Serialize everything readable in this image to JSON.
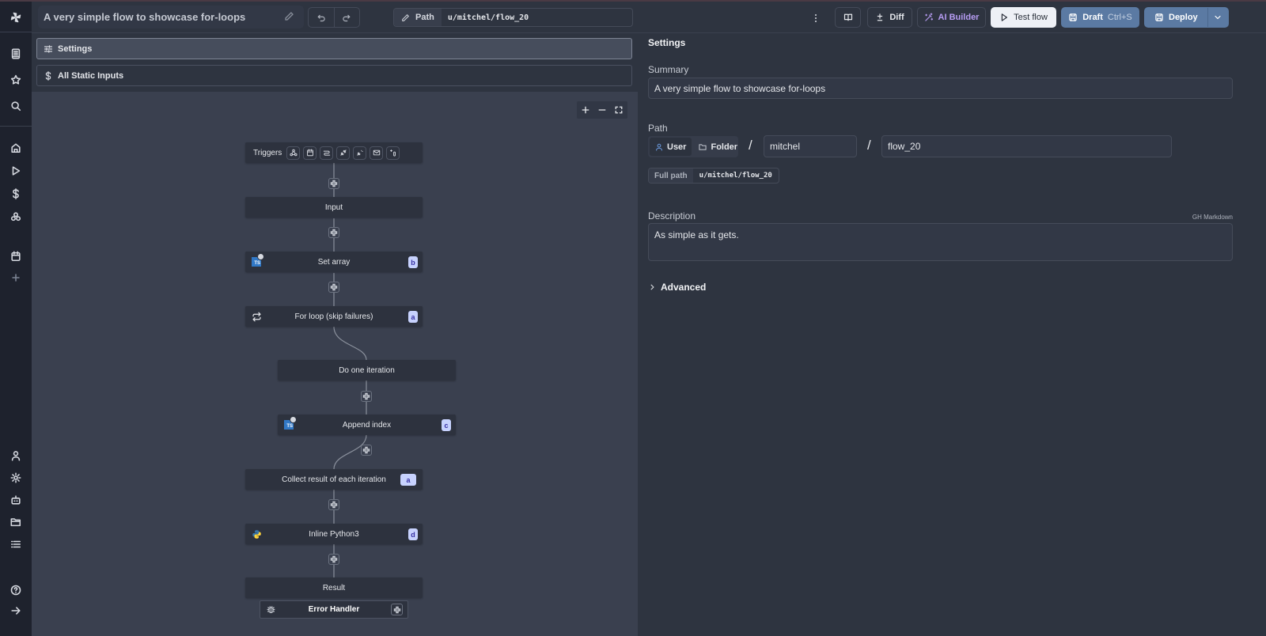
{
  "header": {
    "flow_title": "A very simple flow to showcase for-loops",
    "path_label": "Path",
    "path_value": "u/mitchel/flow_20",
    "buttons": {
      "diff": "Diff",
      "ai_builder": "AI Builder",
      "test_flow": "Test flow",
      "draft": "Draft",
      "draft_shortcut": "Ctrl+S",
      "deploy": "Deploy"
    }
  },
  "sidebar": {
    "top_icons": [
      "script-icon",
      "star-icon",
      "search-icon"
    ],
    "main_icons": [
      "home-icon",
      "play-icon",
      "dollar-icon",
      "resources-icon",
      "calendar-icon",
      "plus-icon"
    ],
    "bottom_icons": [
      "user-icon",
      "gear-icon",
      "bot-icon",
      "folder-icon",
      "list-icon",
      "help-icon",
      "arrow-right-icon"
    ]
  },
  "canvas": {
    "settings_bar": "Settings",
    "static_inputs_bar": "All Static Inputs",
    "triggers_label": "Triggers",
    "trigger_icons": [
      "webhook-icon",
      "schedule-icon",
      "http-route-icon",
      "websocket-icon",
      "kafka-icon",
      "email-icon",
      "database-trigger-icon"
    ],
    "nodes": [
      {
        "label": "Input"
      },
      {
        "label": "Set array",
        "badge": "b",
        "icon": "typescript"
      },
      {
        "label": "For loop (skip failures)",
        "badge": "a",
        "icon": "loop"
      },
      {
        "label": "Do one iteration"
      },
      {
        "label": "Append index",
        "badge": "c",
        "icon": "typescript"
      },
      {
        "label": "Collect result of each iteration",
        "badge": "a"
      },
      {
        "label": "Inline Python3",
        "badge": "d",
        "icon": "python"
      },
      {
        "label": "Result"
      }
    ],
    "error_handler": "Error Handler"
  },
  "settings": {
    "heading": "Settings",
    "summary_label": "Summary",
    "summary_value": "A very simple flow to showcase for-loops",
    "path_label": "Path",
    "owner_options": [
      "User",
      "Folder"
    ],
    "owner_selected": "User",
    "owner_name": "mitchel",
    "flow_name": "flow_20",
    "separator": "/",
    "full_path_label": "Full path",
    "full_path_value": "u/mitchel/flow_20",
    "description_label": "Description",
    "description_hint": "GH Markdown",
    "description_value": "As simple as it gets.",
    "advanced_label": "Advanced"
  },
  "colors": {
    "accent": "#5b7aa3",
    "ai": "#b69cf2",
    "badge_bg": "#c7d2fe",
    "badge_fg": "#3730a3"
  }
}
